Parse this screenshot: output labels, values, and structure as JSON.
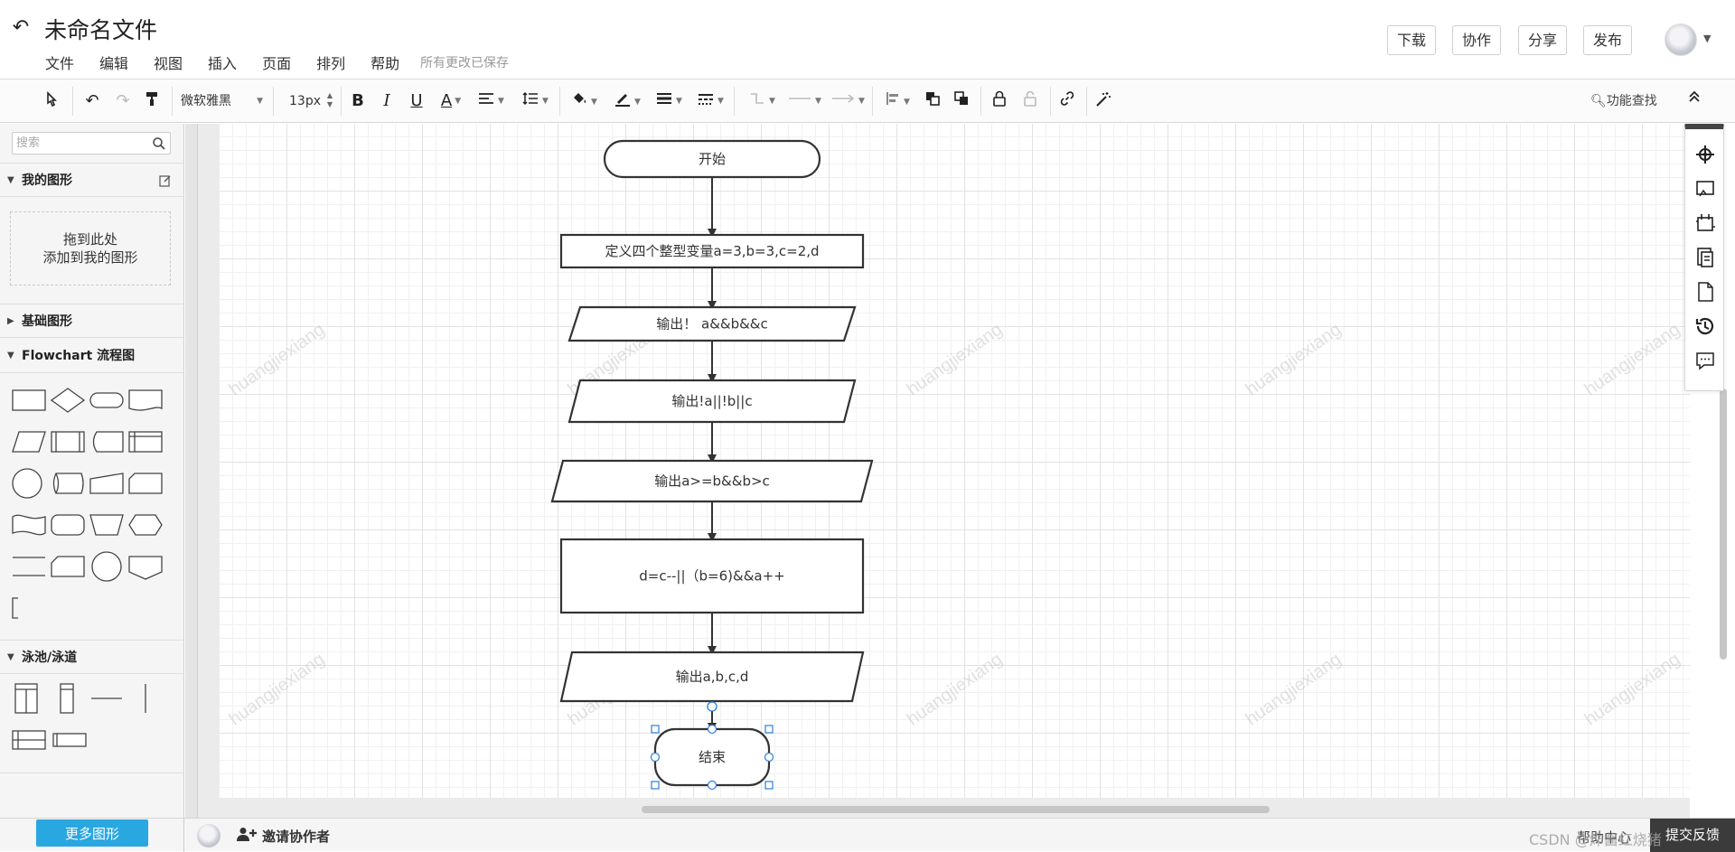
{
  "header": {
    "title": "未命名文件",
    "save_status": "所有更改已保存",
    "menu": [
      "文件",
      "编辑",
      "视图",
      "插入",
      "页面",
      "排列",
      "帮助"
    ],
    "buttons": {
      "download": "下载",
      "collaborate": "协作",
      "share": "分享",
      "publish": "发布"
    }
  },
  "toolbar": {
    "font_family": "微软雅黑",
    "font_size": "13px",
    "function_search": "功能查找"
  },
  "left_panel": {
    "search_placeholder": "搜索",
    "my_shapes": "我的图形",
    "dropzone_line1": "拖到此处",
    "dropzone_line2": "添加到我的图形",
    "basic_shapes": "基础图形",
    "flowchart": "Flowchart 流程图",
    "swimlane": "泳池/泳道",
    "more_shapes": "更多图形"
  },
  "bottom": {
    "invite": "邀请协作者",
    "help": "帮助中心",
    "feedback": "提交反馈",
    "csdn": "CSDN @炸酱红烧猪"
  },
  "watermark": "huangjiexiang",
  "flowchart": [
    {
      "id": "start",
      "type": "terminator",
      "text": "开始"
    },
    {
      "id": "define",
      "type": "process",
      "text": "定义四个整型变量a=3,b=3,c=2,d"
    },
    {
      "id": "out1",
      "type": "io",
      "text": "输出！ a&&b&&c"
    },
    {
      "id": "out2",
      "type": "io",
      "text": "输出!a||!b||c"
    },
    {
      "id": "out3",
      "type": "io",
      "text": "输出a>=b&&b>c"
    },
    {
      "id": "calc",
      "type": "process",
      "text": "d=c--||（b=6)&&a++"
    },
    {
      "id": "out4",
      "type": "io",
      "text": "输出a,b,c,d"
    },
    {
      "id": "end",
      "type": "terminator",
      "text": "结束"
    }
  ]
}
